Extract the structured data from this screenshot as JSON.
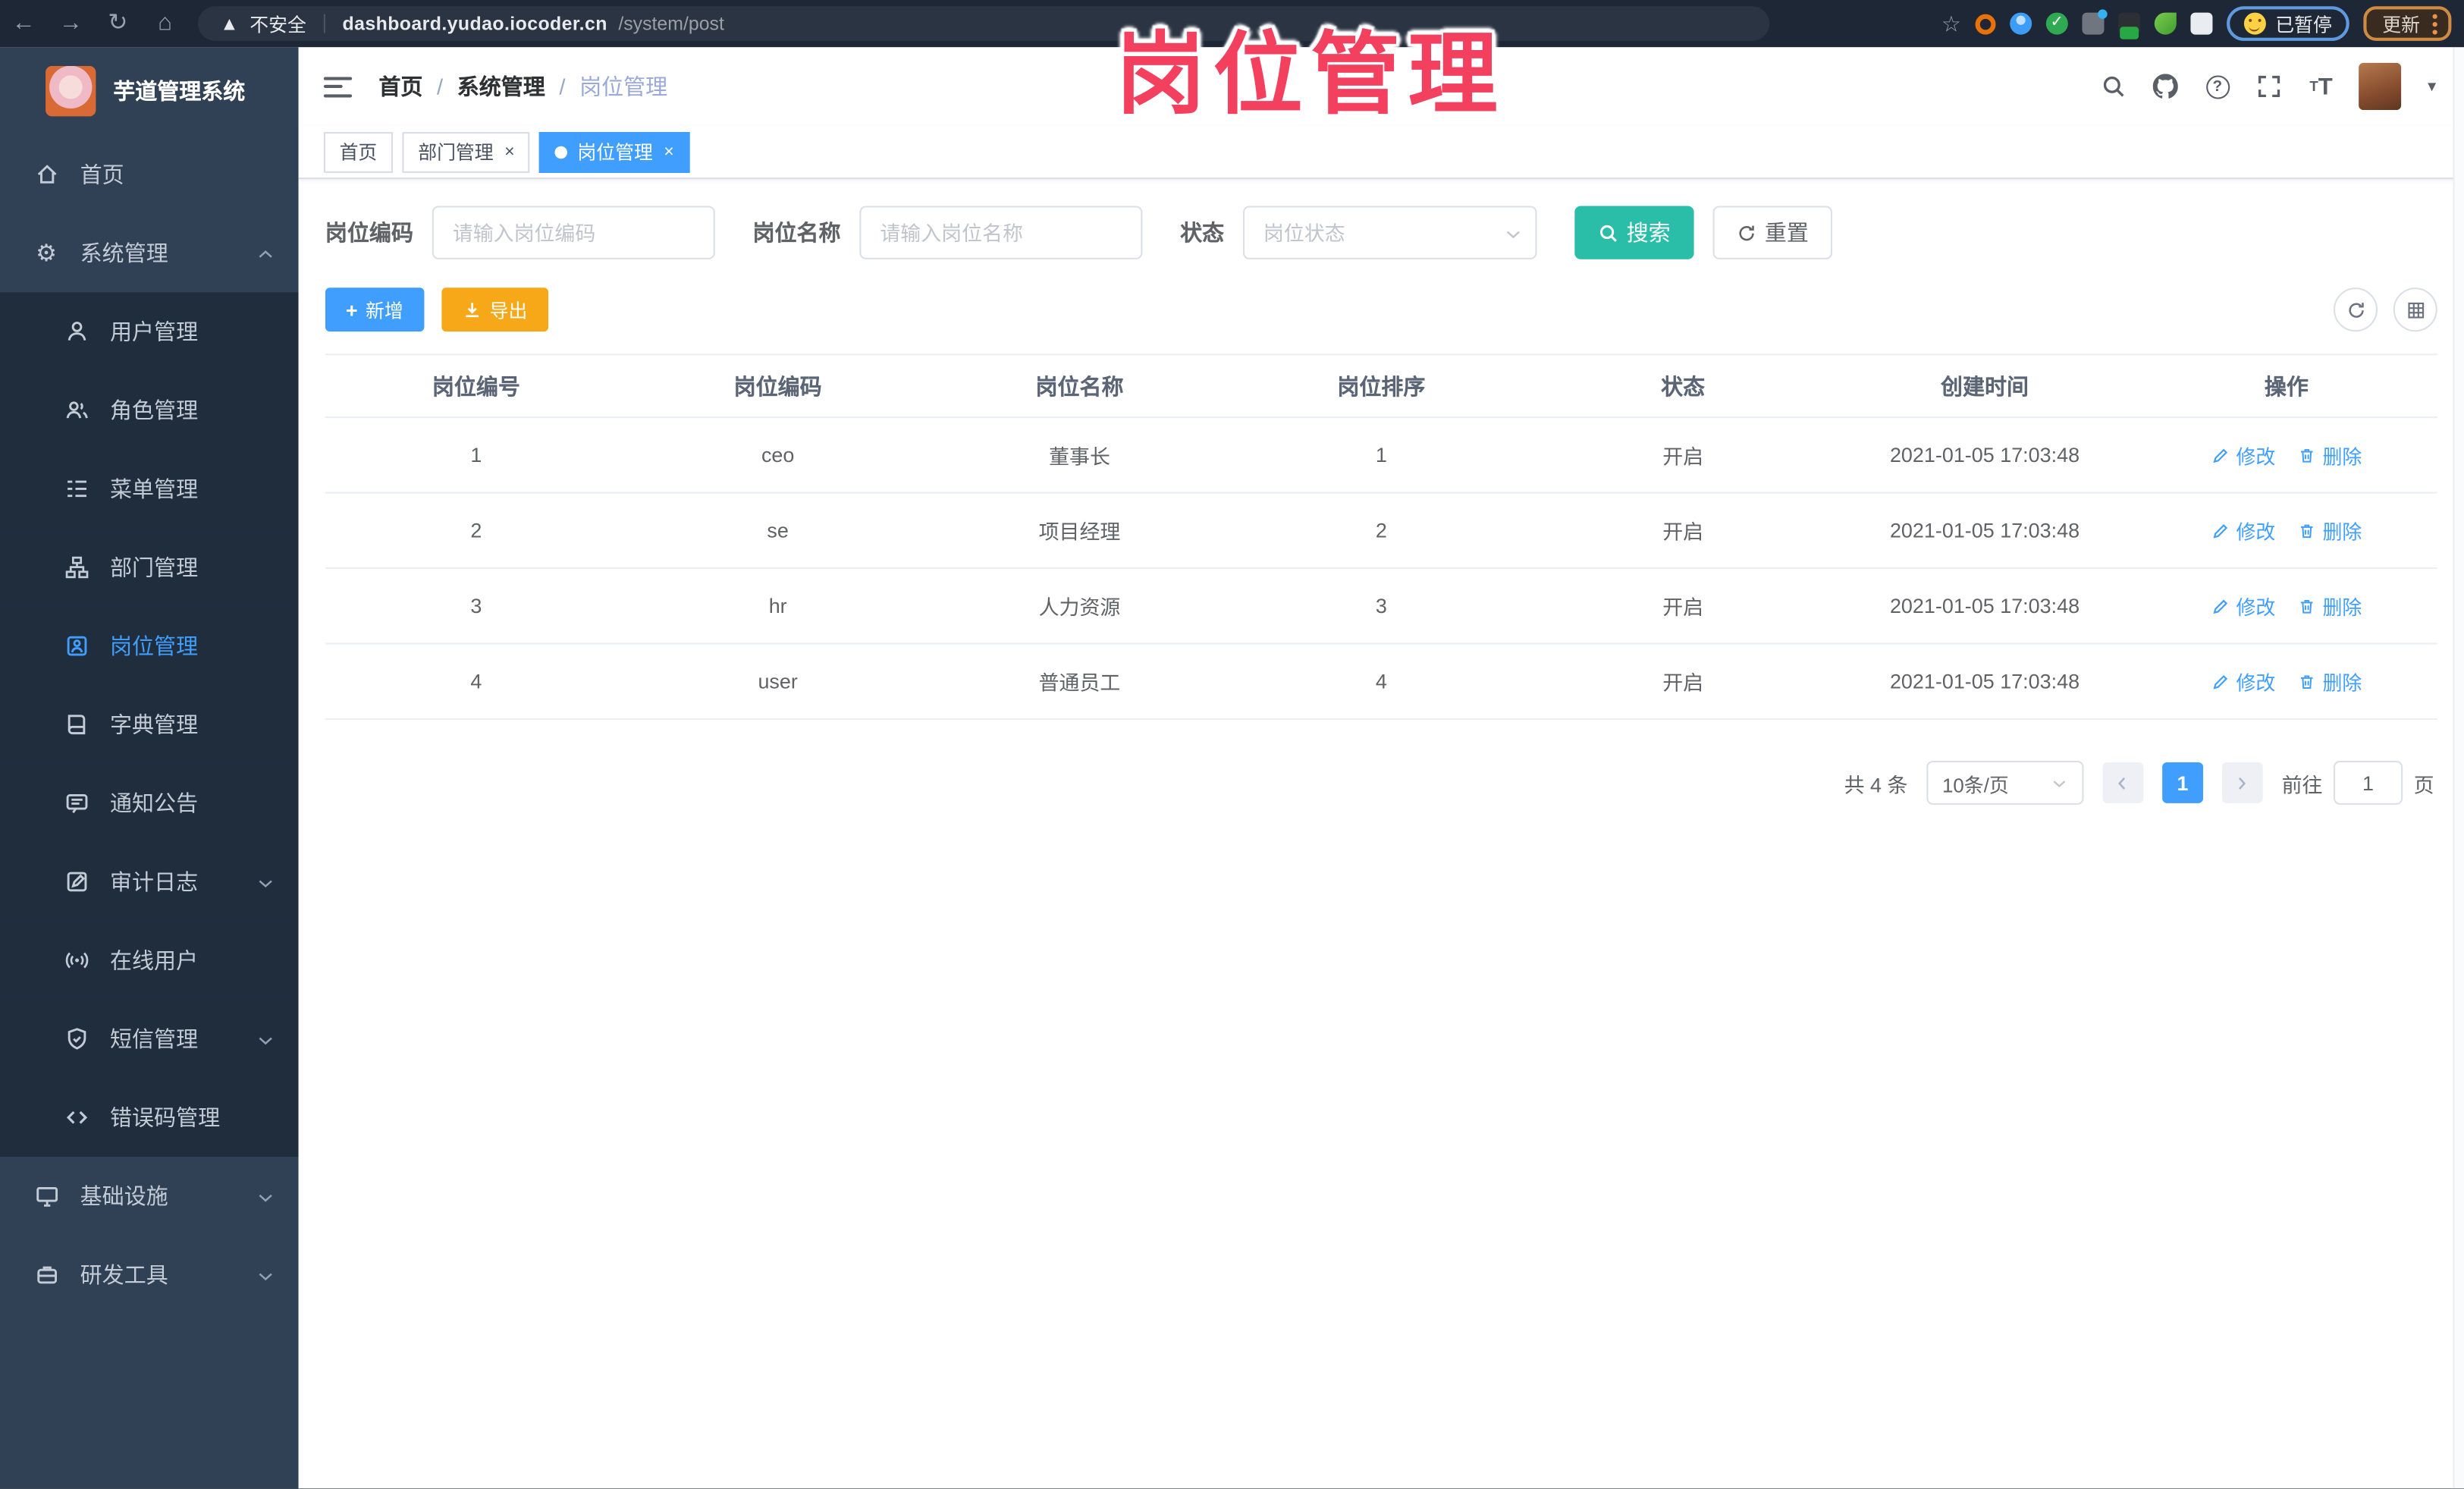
{
  "browser": {
    "security_label": "不安全",
    "url_domain": "dashboard.yudao.iocoder.cn",
    "url_path": "/system/post",
    "paused_label": "已暂停",
    "update_label": "更新"
  },
  "overlay": {
    "title": "岗位管理",
    "color": "#f4405f"
  },
  "sidebar": {
    "app_title": "芋道管理系统",
    "items": [
      {
        "label": "首页",
        "icon": "home-icon"
      },
      {
        "label": "系统管理",
        "icon": "gear-icon",
        "chevron": "up"
      },
      {
        "label": "用户管理",
        "icon": "user-icon"
      },
      {
        "label": "角色管理",
        "icon": "roles-icon"
      },
      {
        "label": "菜单管理",
        "icon": "menu-list-icon"
      },
      {
        "label": "部门管理",
        "icon": "org-tree-icon"
      },
      {
        "label": "岗位管理",
        "icon": "post-badge-icon",
        "active": true
      },
      {
        "label": "字典管理",
        "icon": "dictionary-icon"
      },
      {
        "label": "通知公告",
        "icon": "announcement-icon"
      },
      {
        "label": "审计日志",
        "icon": "audit-log-icon",
        "chevron": "down"
      },
      {
        "label": "在线用户",
        "icon": "online-users-icon"
      },
      {
        "label": "短信管理",
        "icon": "sms-shield-icon",
        "chevron": "down"
      },
      {
        "label": "错误码管理",
        "icon": "error-code-icon"
      },
      {
        "label": "基础设施",
        "icon": "infrastructure-icon",
        "chevron": "down"
      },
      {
        "label": "研发工具",
        "icon": "dev-tools-icon",
        "chevron": "down"
      }
    ]
  },
  "header": {
    "breadcrumb": [
      "首页",
      "系统管理",
      "岗位管理"
    ]
  },
  "tabs": {
    "items": [
      {
        "label": "首页"
      },
      {
        "label": "部门管理"
      },
      {
        "label": "岗位管理",
        "active": true
      }
    ]
  },
  "filters": {
    "code_label": "岗位编码",
    "code_placeholder": "请输入岗位编码",
    "name_label": "岗位名称",
    "name_placeholder": "请输入岗位名称",
    "status_label": "状态",
    "status_placeholder": "岗位状态",
    "search_label": "搜索",
    "reset_label": "重置"
  },
  "toolbar": {
    "add_label": "新增",
    "export_label": "导出"
  },
  "table": {
    "headers": [
      "岗位编号",
      "岗位编码",
      "岗位名称",
      "岗位排序",
      "状态",
      "创建时间",
      "操作"
    ],
    "edit_label": "修改",
    "delete_label": "删除",
    "rows": [
      {
        "id": "1",
        "code": "ceo",
        "name": "董事长",
        "sort": "1",
        "status": "开启",
        "created": "2021-01-05 17:03:48"
      },
      {
        "id": "2",
        "code": "se",
        "name": "项目经理",
        "sort": "2",
        "status": "开启",
        "created": "2021-01-05 17:03:48"
      },
      {
        "id": "3",
        "code": "hr",
        "name": "人力资源",
        "sort": "3",
        "status": "开启",
        "created": "2021-01-05 17:03:48"
      },
      {
        "id": "4",
        "code": "user",
        "name": "普通员工",
        "sort": "4",
        "status": "开启",
        "created": "2021-01-05 17:03:48"
      }
    ]
  },
  "pagination": {
    "total": "共 4 条",
    "page_size": "10条/页",
    "current_page": "1",
    "goto_label": "前往",
    "goto_value": "1",
    "page_unit": "页"
  },
  "colors": {
    "primary": "#409eff",
    "search_button": "#2abda7",
    "export_button": "#f6a818",
    "sidebar_bg": "#304156",
    "submenu_bg": "#1f2d3d",
    "overlay_text": "#f4405f"
  }
}
